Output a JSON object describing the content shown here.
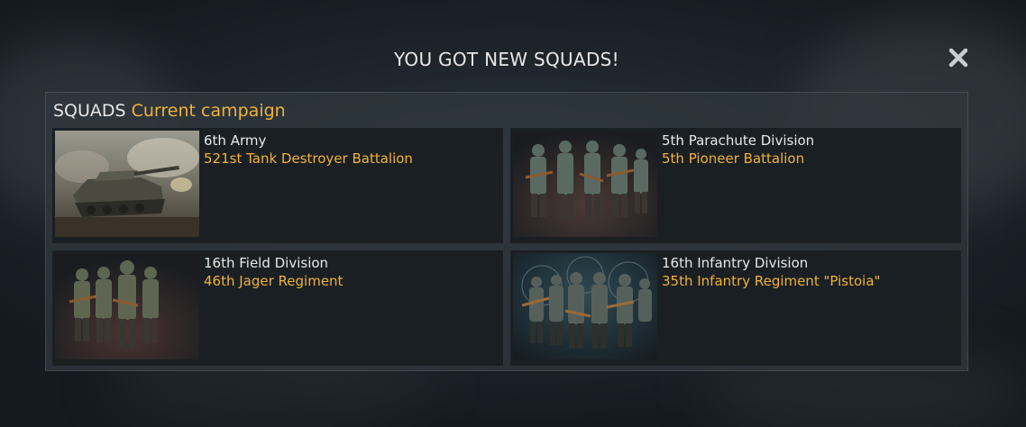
{
  "dialog": {
    "title": "YOU GOT NEW SQUADS!",
    "close_icon": "close-icon"
  },
  "panel": {
    "label": "SQUADS",
    "campaign": "Current campaign"
  },
  "squads": [
    {
      "division": "6th Army",
      "unit": "521st Tank Destroyer Battalion",
      "image": "tank-destroyer-image"
    },
    {
      "division": "5th Parachute Division",
      "unit": "5th Pioneer Battalion",
      "image": "paratrooper-squad-image"
    },
    {
      "division": "16th Field Division",
      "unit": "46th Jager Regiment",
      "image": "jager-squad-image"
    },
    {
      "division": "16th Infantry Division",
      "unit": "35th Infantry Regiment \"Pistoia\"",
      "image": "infantry-squad-image"
    }
  ],
  "colors": {
    "accent": "#f0b238",
    "text": "#e8e8e8",
    "card_bg": "#181c20",
    "panel_bg": "#30373e"
  }
}
